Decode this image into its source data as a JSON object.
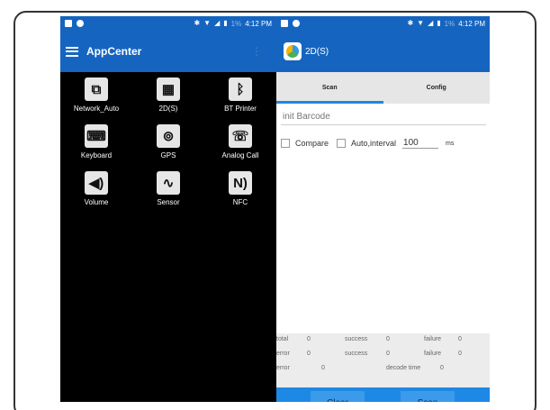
{
  "left_phone": {
    "status_bar": {
      "time": "4:12 PM",
      "battery": "1%"
    },
    "app_title": "AppCenter",
    "apps": [
      {
        "label": "Network_Auto",
        "icon": "network-icon"
      },
      {
        "label": "2D(S)",
        "icon": "qr-code-icon"
      },
      {
        "label": "BT Printer",
        "icon": "bluetooth-icon"
      },
      {
        "label": "Keyboard",
        "icon": "keyboard-icon"
      },
      {
        "label": "GPS",
        "icon": "satellite-icon"
      },
      {
        "label": "Analog Call",
        "icon": "phone-icon"
      },
      {
        "label": "Volume",
        "icon": "volume-icon"
      },
      {
        "label": "Sensor",
        "icon": "sensor-icon"
      },
      {
        "label": "NFC",
        "icon": "nfc-icon"
      }
    ]
  },
  "right_phone": {
    "status_bar": {
      "time": "4:12 PM",
      "battery": "1%"
    },
    "app_title": "2D(S)",
    "tabs": {
      "scan": "Scan",
      "config": "Config"
    },
    "barcode_input": {
      "placeholder": "init Barcode"
    },
    "options": {
      "compare_label": "Compare",
      "auto_interval_label": "Auto,interval",
      "interval_value": "100",
      "interval_unit": "ms"
    },
    "stats": {
      "row1": {
        "total_label": "total",
        "total_value": "0",
        "success_label": "success",
        "success_value": "0",
        "failure_label": "failure",
        "failure_value": "0"
      },
      "row2": {
        "error_label": "error",
        "error_value": "0",
        "success_label": "success",
        "success_value": "0",
        "failure_label": "failure",
        "failure_value": "0"
      },
      "row3": {
        "error_label": "error",
        "error_value": "0",
        "decode_time_label": "decode time",
        "decode_time_value": "0"
      }
    },
    "buttons": {
      "clear": "Clear",
      "scan": "Scan"
    }
  },
  "colors": {
    "primary": "#1565c0",
    "accent": "#1e88e5",
    "button": "#3b9bea"
  }
}
